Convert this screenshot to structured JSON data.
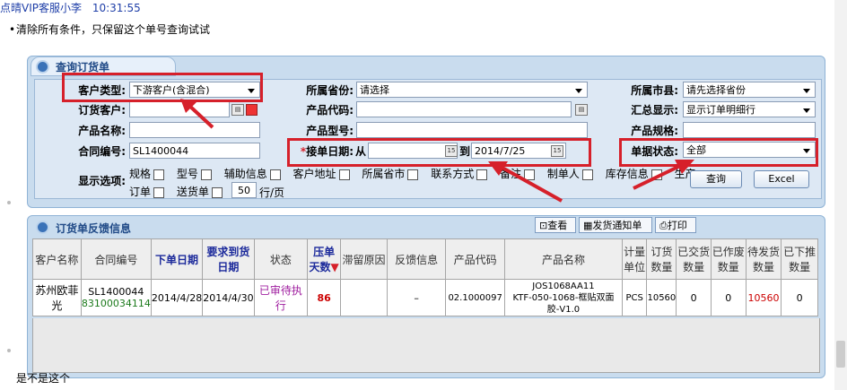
{
  "chat": {
    "sender": "点晴VIP客服小李",
    "time": "10:31:55",
    "message1": "清除所有条件，只保留这个单号查询试试",
    "message2": "是不是这个"
  },
  "query_panel": {
    "title": "查询订货单",
    "customer_type_label": "客户类型:",
    "customer_type_value": "下游客户(含混合)",
    "province_label": "所属省份:",
    "province_value": "请选择",
    "city_label": "所属市县:",
    "city_value": "请先选择省份",
    "order_customer_label": "订货客户:",
    "product_code_label": "产品代码:",
    "summary_label": "汇总显示:",
    "summary_value": "显示订单明细行",
    "product_name_label": "产品名称:",
    "product_model_label": "产品型号:",
    "product_spec_label": "产品规格:",
    "contract_no_label": "合同编号:",
    "contract_no_value": "SL1400044",
    "order_date_label": "*接单日期:",
    "from_label": "从",
    "to_label": "到",
    "date_to_value": "2014/7/25",
    "doc_status_label": "单据状态:",
    "doc_status_value": "全部",
    "display_options_label": "显示选项:",
    "options_row1": [
      "规格",
      "型号",
      "辅助信息",
      "客户地址",
      "所属省市",
      "联系方式",
      "备注",
      "制单人",
      "库存信息",
      "生产"
    ],
    "options_row2": [
      "订单",
      "送货单"
    ],
    "page_size_value": "50",
    "page_size_suffix": "行/页",
    "query_button": "查询",
    "excel_button": "Excel"
  },
  "feedback_panel": {
    "title": "订货单反馈信息",
    "view_button": "查看",
    "ship_notice_button": "发货通知单",
    "print_button": "打印",
    "columns": [
      "客户名称",
      "合同编号",
      "下单日期",
      "要求到货日期",
      "状态",
      "压单天数",
      "滞留原因",
      "反馈信息",
      "产品代码",
      "产品名称",
      "计量单位",
      "订货数量",
      "已交货数量",
      "已作废数量",
      "待发货数量",
      "已下推数量"
    ],
    "rows": [
      {
        "customer": "苏州欧菲光",
        "contract_no": "SL1400044",
        "contract_sub": "83100034114",
        "order_date": "2014/4/28",
        "due_date": "2014/4/30",
        "status": "已审待执行",
        "pending_days": "86",
        "delay_reason": "",
        "feedback": "–",
        "product_code": "02.1000097",
        "product_name_line1": "JOS1068AA11",
        "product_name_line2": "KTF-050-1068-框贴双面",
        "product_name_line3": "胶-V1.0",
        "unit": "PCS",
        "order_qty": "10560",
        "delivered_qty": "0",
        "voided_qty": "0",
        "to_ship_qty": "10560",
        "pushed_qty": "0"
      }
    ]
  }
}
